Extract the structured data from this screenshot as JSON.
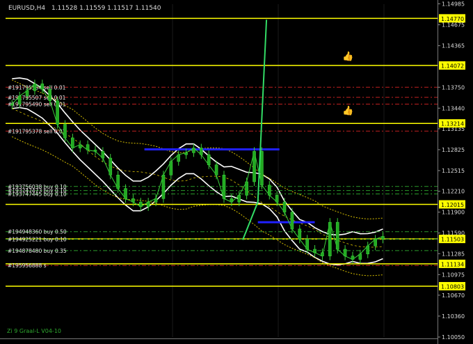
{
  "chart_data": {
    "type": "line",
    "header": {
      "symbol": "EURUSD,H4",
      "ohlc": "1.11528 1.11559 1.11517 1.11540"
    },
    "footer_label": "Zi 9 Graal-L V04-10",
    "ylim": [
      1.1005,
      1.1498
    ],
    "price_ticks": [
      "1.14985",
      "1.14675",
      "1.14365",
      "1.13750",
      "1.13440",
      "1.13135",
      "1.12825",
      "1.12515",
      "1.12210",
      "1.11900",
      "1.11590",
      "1.11285",
      "1.10975",
      "1.10670",
      "1.10360",
      "1.10050"
    ],
    "yellow_levels": [
      {
        "label": "1.14770",
        "value": 1.1477
      },
      {
        "label": "1.14072",
        "value": 1.14072
      },
      {
        "label": "1.13214",
        "value": 1.13214
      },
      {
        "label": "1.12015",
        "value": 1.12015
      },
      {
        "label": "1.11503",
        "value": 1.11503
      },
      {
        "label": "1.11134",
        "value": 1.11134
      },
      {
        "label": "1.10803",
        "value": 1.10803
      }
    ],
    "order_labels": [
      {
        "text": "#191795584 sell 0.01",
        "value": 1.1375
      },
      {
        "text": "#191795507 sell 0.01",
        "value": 1.136
      },
      {
        "text": "#191795490 sell 0.01",
        "value": 1.135
      },
      {
        "text": "#191795378 sell 0.01",
        "value": 1.131
      },
      {
        "text": "#193756038 buy 0.10",
        "value": 1.1228
      },
      {
        "text": "#193747473 buy 0.10",
        "value": 1.1222
      },
      {
        "text": "#193747445 buy 0.10",
        "value": 1.1217
      },
      {
        "text": "#194948360 buy 0.50",
        "value": 1.1161
      },
      {
        "text": "#194925221 buy 0.10",
        "value": 1.115
      },
      {
        "text": "#194878480 buy 0.35",
        "value": 1.1133
      },
      {
        "text": "#195956888 s",
        "value": 1.1111
      }
    ],
    "blue_zones": [
      {
        "x0": 0.08,
        "x1": 0.635,
        "value": 1.1283
      },
      {
        "x0": 0.475,
        "x1": 0.585,
        "value": 1.1175
      }
    ],
    "price_series": [
      1.135,
      1.1362,
      1.137,
      1.138,
      1.1372,
      1.1355,
      1.132,
      1.13,
      1.1285,
      1.129,
      1.1282,
      1.128,
      1.127,
      1.1245,
      1.1225,
      1.121,
      1.1205,
      1.1198,
      1.1205,
      1.121,
      1.1245,
      1.1265,
      1.1275,
      1.1278,
      1.1285,
      1.1275,
      1.126,
      1.1245,
      1.121,
      1.1205,
      1.1215,
      1.1235,
      1.128,
      1.123,
      1.1215,
      1.1205,
      1.119,
      1.1165,
      1.115,
      1.1135,
      1.113,
      1.1125,
      1.1175,
      1.1135,
      1.1125,
      1.112,
      1.1128,
      1.114,
      1.115,
      1.1154
    ],
    "forecast_arrow": {
      "points": [
        [
          0.55,
          1.1149
        ],
        [
          0.585,
          1.1205
        ],
        [
          0.605,
          1.1475
        ]
      ]
    }
  }
}
